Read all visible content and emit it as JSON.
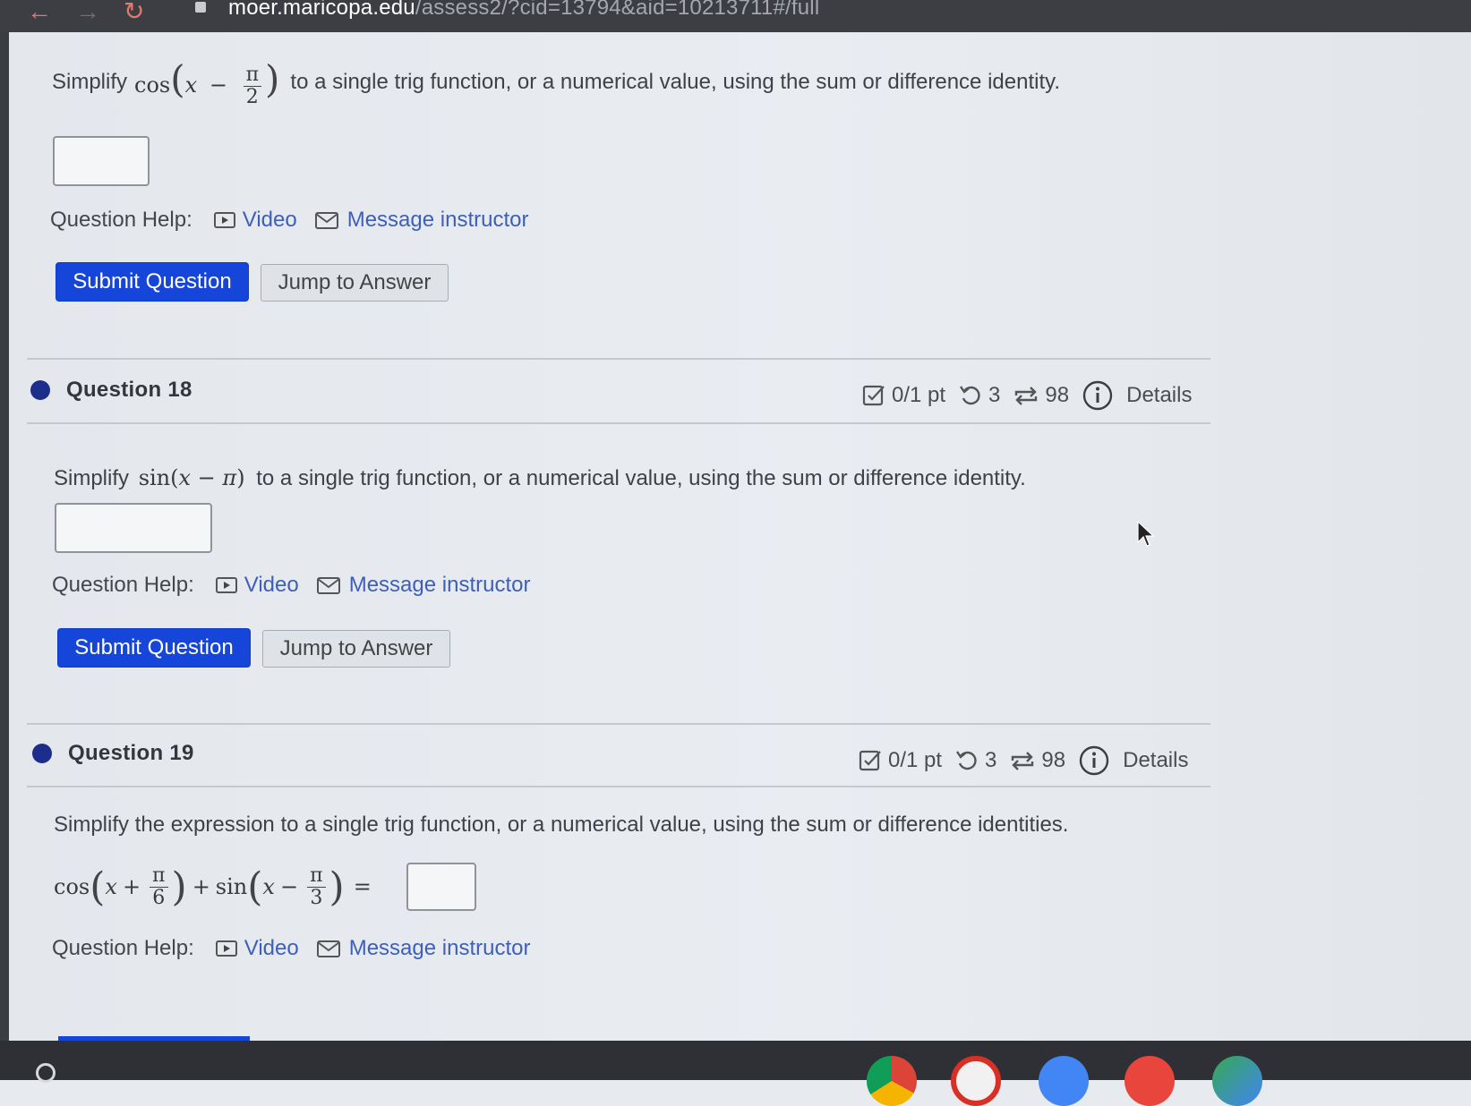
{
  "browser": {
    "url_host": "moer.maricopa.edu",
    "url_path": "/assess2/?cid=13794&aid=10213711#/full"
  },
  "question17": {
    "prefix": "Simplify",
    "func": "cos",
    "var": "x",
    "minus": "−",
    "frac_num": "π",
    "frac_den": "2",
    "suffix": "to a single trig function, or a numerical value, using the sum or difference identity.",
    "help_label": "Question Help:",
    "video_label": "Video",
    "message_label": "Message instructor",
    "submit_label": "Submit Question",
    "jump_label": "Jump to Answer"
  },
  "question18": {
    "title": "Question 18",
    "points": "0/1 pt",
    "retries": "3",
    "attempts": "98",
    "details_label": "Details",
    "prefix": "Simplify",
    "expr_func": "sin",
    "expr_inner": "x − π",
    "suffix": "to a single trig function, or a numerical value, using the sum or difference identity.",
    "help_label": "Question Help:",
    "video_label": "Video",
    "message_label": "Message instructor",
    "submit_label": "Submit Question",
    "jump_label": "Jump to Answer"
  },
  "question19": {
    "title": "Question 19",
    "points": "0/1 pt",
    "retries": "3",
    "attempts": "98",
    "details_label": "Details",
    "text": "Simplify the expression to a single trig function, or a numerical value, using the sum or difference identities.",
    "cos_func": "cos",
    "sin_func": "sin",
    "var": "x",
    "plus": "+",
    "minus": "−",
    "equals": "=",
    "frac1_num": "π",
    "frac1_den": "6",
    "frac2_num": "π",
    "frac2_den": "3",
    "help_label": "Question Help:",
    "video_label": "Video",
    "message_label": "Message instructor"
  }
}
